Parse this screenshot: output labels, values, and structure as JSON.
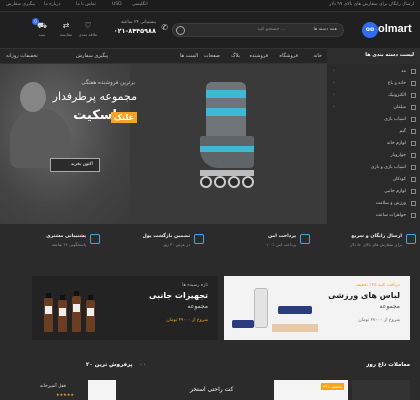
{
  "topbar": {
    "promo": "ارسال رایگان برای سفارش های بالای ۹۹ دلار",
    "links": [
      "پیگیری سفارش",
      "درباره ما",
      "تماس با ما"
    ],
    "currency": "USD",
    "language": "انگلیسی"
  },
  "header": {
    "logo_text": "olmart",
    "search_placeholder": "جستجو کنید ...",
    "search_category": "همه دسته ها",
    "support_label": "پشتیبانی ۲۴ ساعته",
    "support_phone": "۰۲۱-۸۴۴۵۹۸۸",
    "compare_label": "مقایسه",
    "wishlist_label": "علاقه مندی",
    "cart_label": "سبد",
    "cart_count": "0"
  },
  "nav": {
    "categories_title": "لیست دسته بندی ها",
    "items": [
      "خانه",
      "فروشگاه",
      "فروشنده",
      "بلاگ",
      "صفحات",
      "المنت ها"
    ],
    "right_note": "پیگیری سفارش",
    "left_note": "تخفیفات روزانه"
  },
  "sidebar": {
    "items": [
      "مد",
      "خانه و باغ",
      "الکترونیک",
      "مبلمان",
      "اسباب بازی",
      "گیم",
      "لوازم خانه",
      "خواروبار",
      "اسباب بازی و بازی",
      "کودکان",
      "لوازم جانبی",
      "ورزش و سلامت",
      "جواهرات ساعت"
    ]
  },
  "hero": {
    "subtitle": "برترین فروشنده هفتگی",
    "title_line1": "مجموعه پرطرفدار",
    "title_line2": "اسکیت",
    "title_tag": "غلتک",
    "button_label": "اکنون بخرید"
  },
  "features": [
    {
      "title": "ارسال رایگان و سریع",
      "desc": "برای سفارش های بالای ۵۰ دلار"
    },
    {
      "title": "پرداخت امن",
      "desc": "۱۰۰٪ پرداخت امن"
    },
    {
      "title": "تضمین بازگشت پول",
      "desc": "در عرض ۳۰ روز"
    },
    {
      "title": "پشتیبانی مشتری",
      "desc": "پاسخگویی ۲۴ ساعته"
    }
  ],
  "banners": {
    "left": {
      "subtitle": "تازه رسیده ها",
      "title": "تجهیزات جانبی",
      "title2": "مجموعه",
      "price": "شروع از ۴۹۰۰۰ تومان"
    },
    "right": {
      "subtitle": "دریافت کنید ۲۵٪ تخفیف",
      "title": "لباس های ورزشی",
      "title2": "مجموعه",
      "price": "شروع از ۲۷۰۰۰ تومان"
    }
  },
  "sections": {
    "deals_title": "معاملات داغ روز",
    "top_title": "۲۰ پرفروش ترین",
    "card_title": "کت راحتی استخر",
    "sale_badge": "۳۲٪ تخفیف",
    "small_card_title": "قفل آشپزخانه"
  },
  "colors": {
    "accent": "#2f6df2",
    "orange": "#f6a320",
    "sky": "#3fb7d6"
  }
}
